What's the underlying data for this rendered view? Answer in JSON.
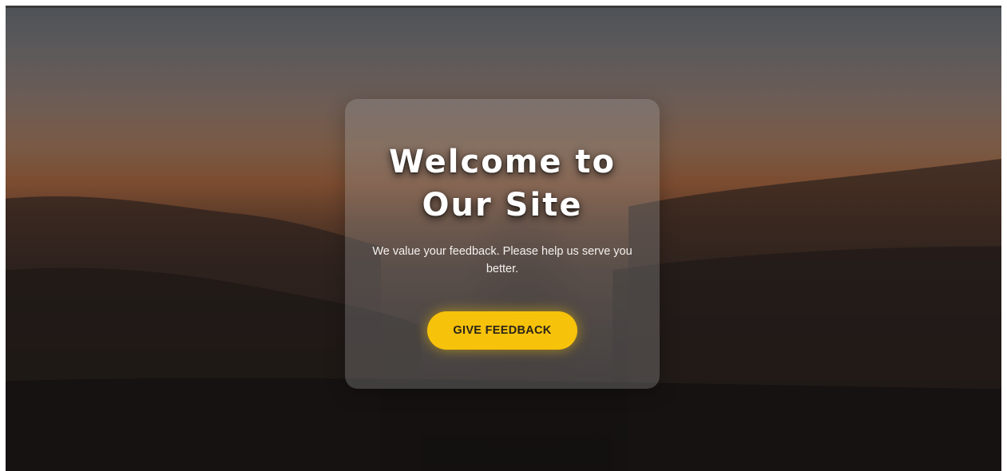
{
  "hero": {
    "title_line1": "Welcome to",
    "title_line2": "Our Site",
    "subtitle": "We value your feedback. Please help us serve you better.",
    "cta_label": "GIVE FEEDBACK",
    "accent_color": "#f7c20a",
    "background": "sunset-silhouette-image"
  }
}
